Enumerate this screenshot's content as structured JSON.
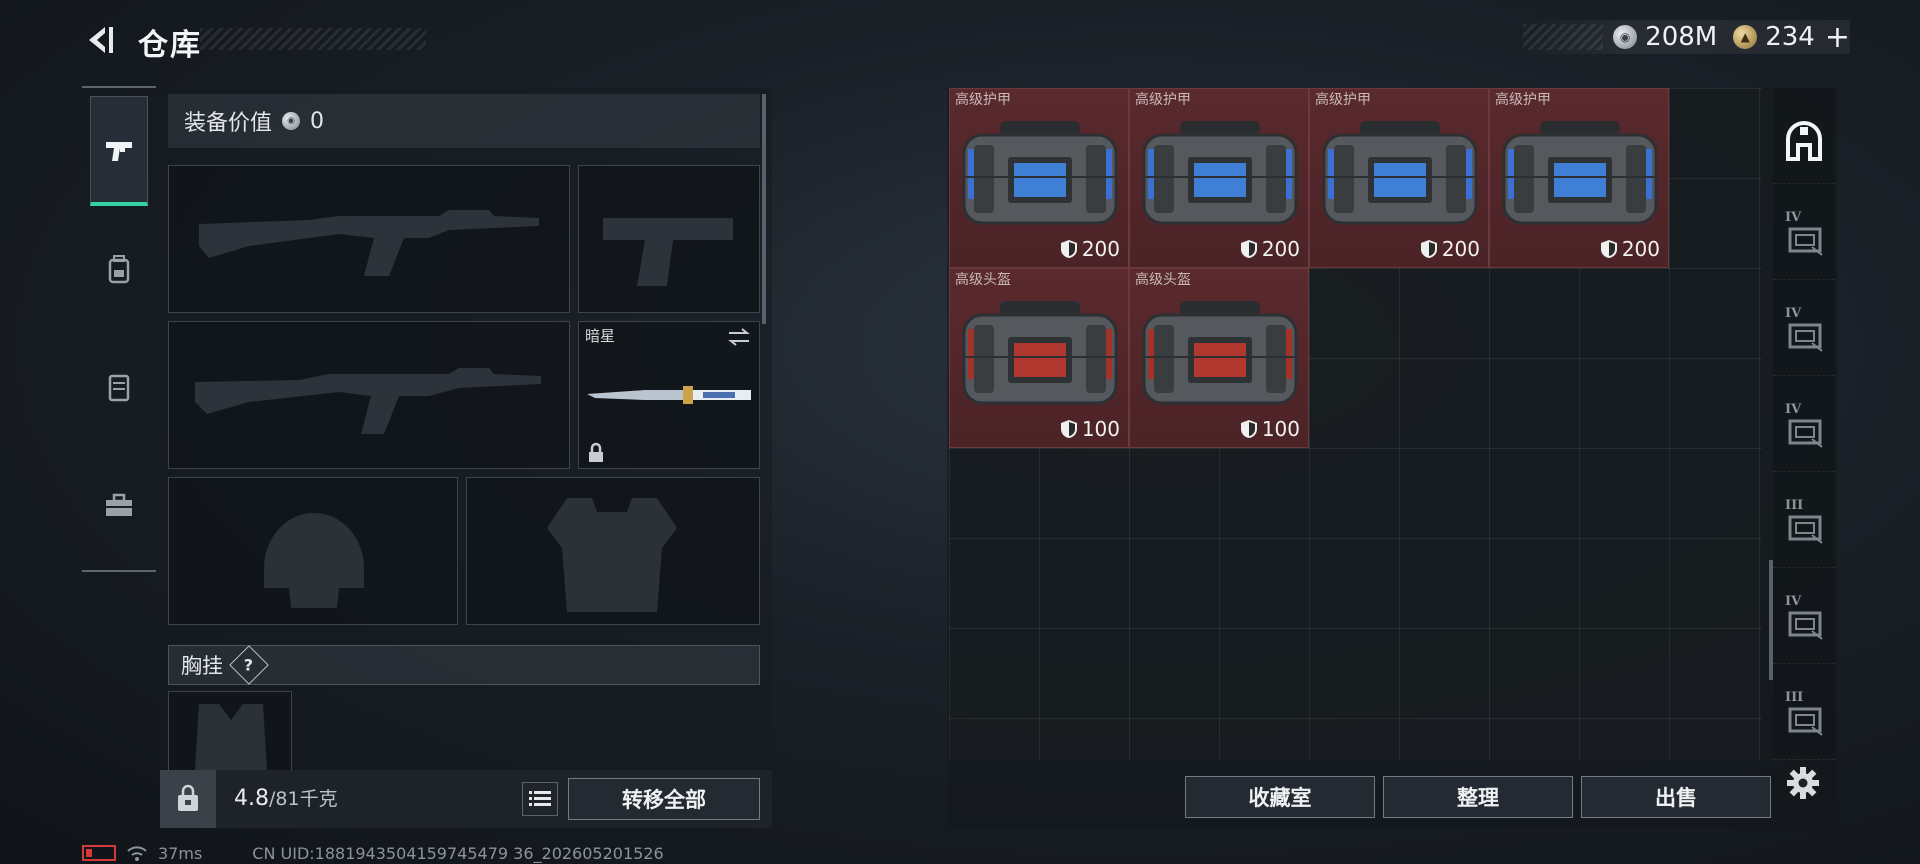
{
  "header": {
    "title": "仓库",
    "currency": [
      {
        "icon": "silver-coin-icon",
        "value": "208M"
      },
      {
        "icon": "gold-coin-icon",
        "value": "234"
      }
    ]
  },
  "left_rail": {
    "tabs": [
      {
        "icon": "pistol-icon",
        "active": true
      },
      {
        "icon": "backpack-icon",
        "active": false
      },
      {
        "icon": "vest-icon",
        "active": false
      },
      {
        "icon": "toolbox-icon",
        "active": false
      }
    ]
  },
  "equipment": {
    "value_label": "装备价值",
    "value": "0",
    "melee_slot_name": "暗星",
    "chest_rig_label": "胸挂",
    "help_mark": "?",
    "weight_current": "4.8",
    "weight_max": "/81千克",
    "transfer_all_label": "转移全部"
  },
  "status": {
    "ping": "37ms",
    "uid": "CN UID:1881943504159745479 36_202605201526"
  },
  "storage": {
    "items": [
      {
        "name": "高级护甲",
        "durability": "200",
        "color": "blue"
      },
      {
        "name": "高级护甲",
        "durability": "200",
        "color": "blue"
      },
      {
        "name": "高级护甲",
        "durability": "200",
        "color": "blue"
      },
      {
        "name": "高级护甲",
        "durability": "200",
        "color": "blue"
      },
      {
        "name": "高级头盔",
        "durability": "100",
        "color": "red"
      },
      {
        "name": "高级头盔",
        "durability": "100",
        "color": "red"
      }
    ],
    "actions": {
      "collection": "收藏室",
      "organize": "整理",
      "sell": "出售"
    },
    "rail_tabs": [
      {
        "icon": "storage-home-icon",
        "active": true
      },
      {
        "icon": "storage-case-iv-icon",
        "tier": "IV"
      },
      {
        "icon": "storage-folder-iv-icon",
        "tier": "IV"
      },
      {
        "icon": "storage-case-iv-icon",
        "tier": "IV"
      },
      {
        "icon": "storage-triangle-iii-icon",
        "tier": "III"
      },
      {
        "icon": "storage-folder-iv-icon",
        "tier": "IV"
      },
      {
        "icon": "storage-gun-iii-icon",
        "tier": "III"
      }
    ]
  },
  "colors": {
    "accent": "#34d1a3",
    "item_bg": "#5a2a2d"
  }
}
